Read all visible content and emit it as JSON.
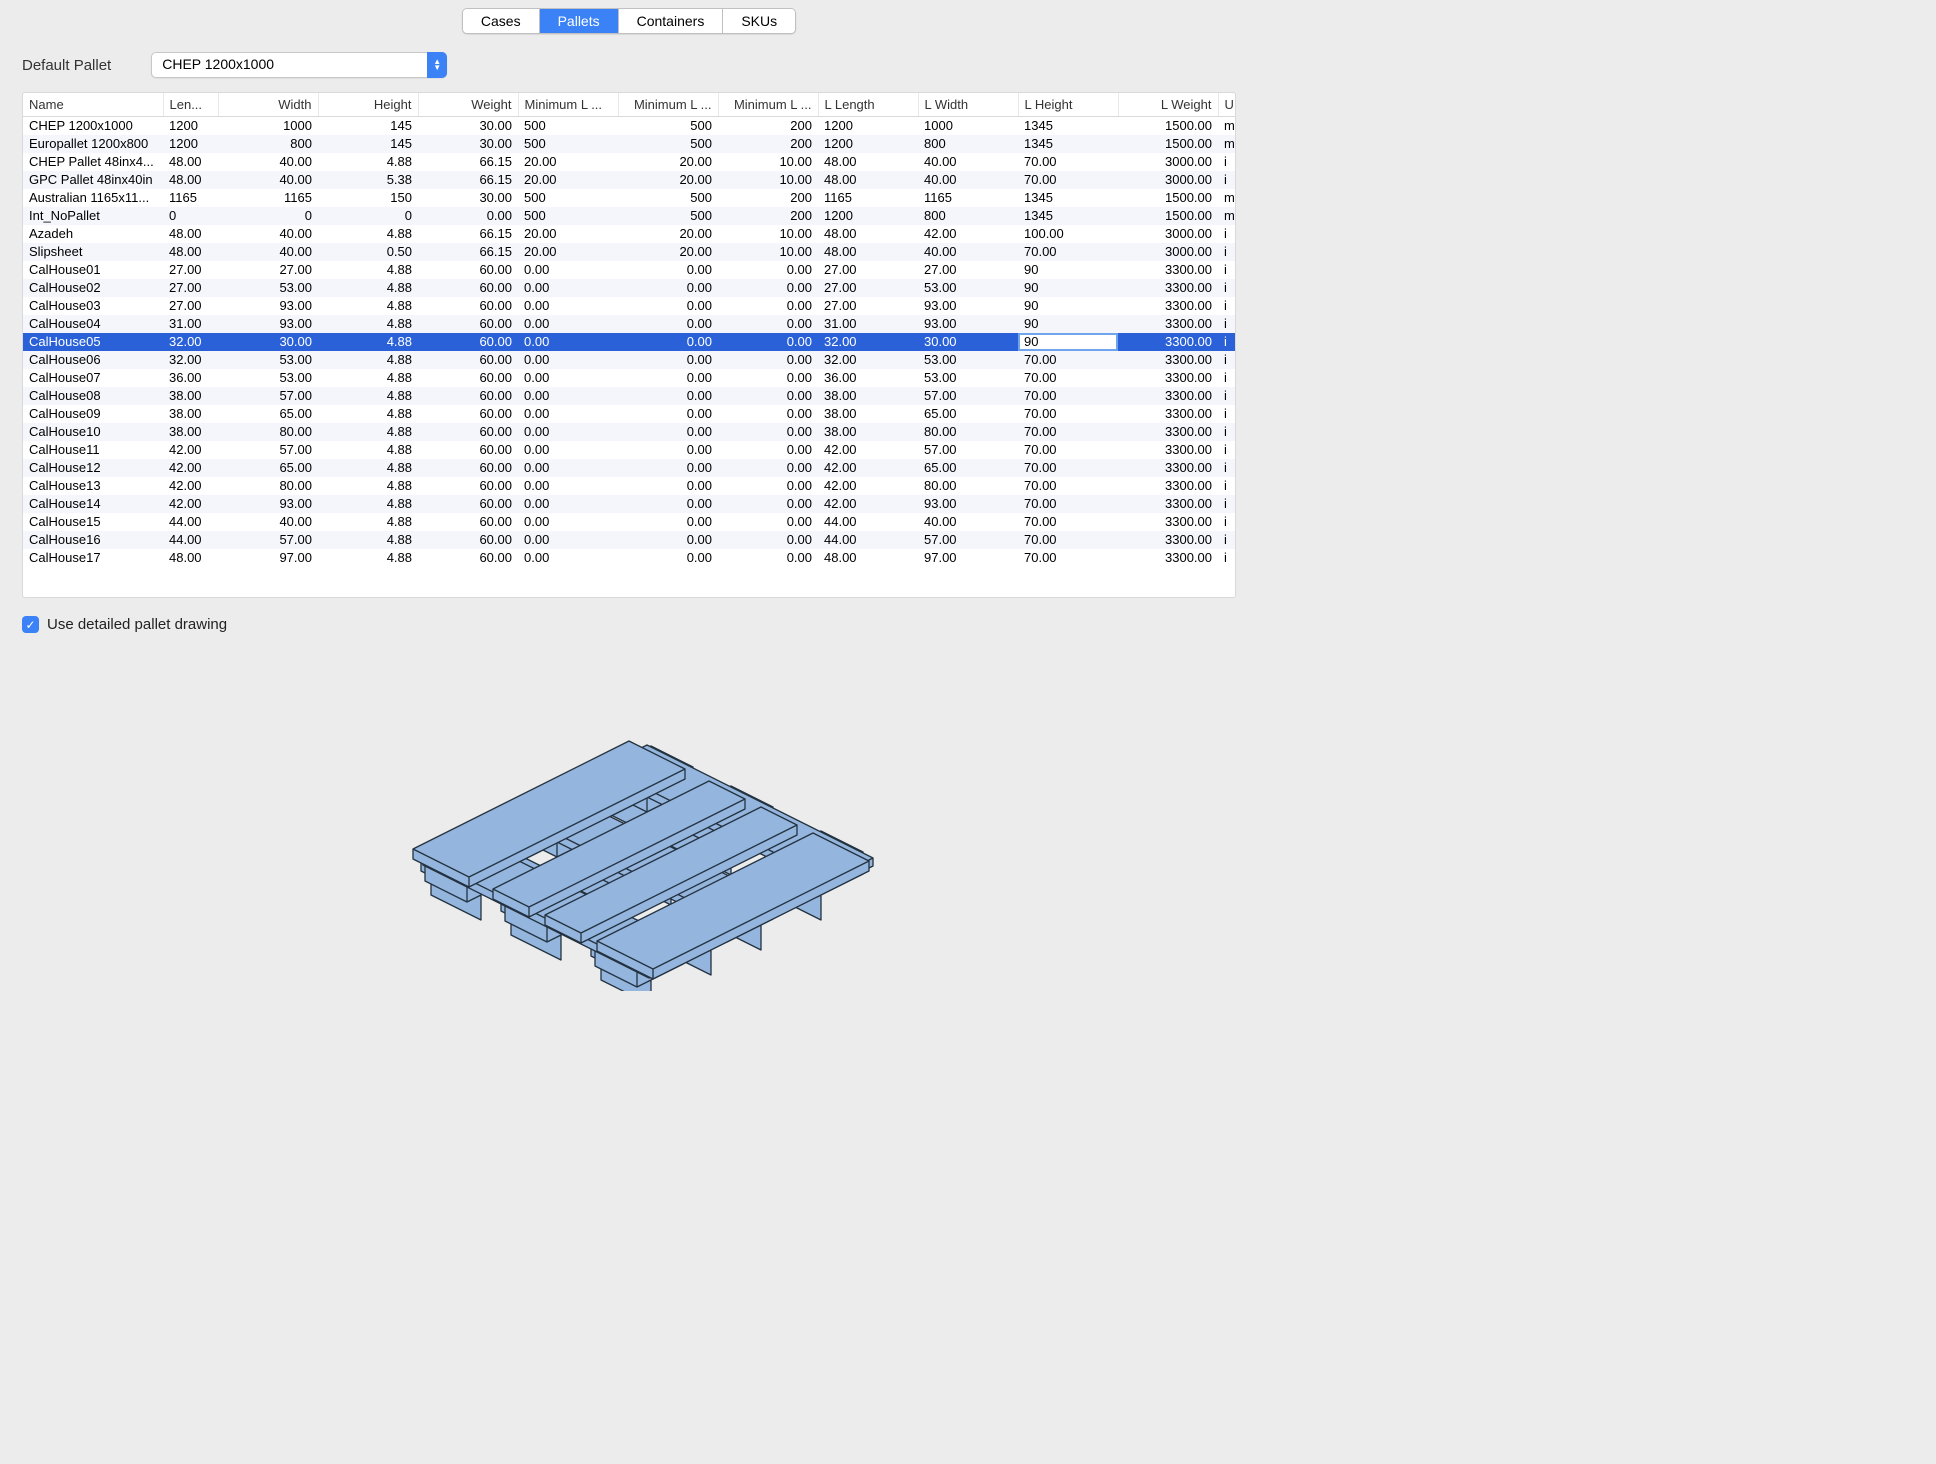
{
  "tabs": {
    "cases": "Cases",
    "pallets": "Pallets",
    "containers": "Containers",
    "skus": "SKUs"
  },
  "default_pallet": {
    "label": "Default Pallet",
    "value": "CHEP 1200x1000"
  },
  "columns": [
    "Name",
    "Len...",
    "Width",
    "Height",
    "Weight",
    "Minimum L ...",
    "Minimum L ...",
    "Minimum L ...",
    "L Length",
    "L Width",
    "L Height",
    "L Weight",
    "U..."
  ],
  "rows": [
    {
      "name": "CHEP 1200x1000",
      "len": "1200",
      "width": "1000",
      "height": "145",
      "weight": "30.00",
      "ml1": "500",
      "ml2": "500",
      "ml3": "200",
      "ll": "1200",
      "lw": "1000",
      "lh": "1345",
      "lwgt": "1500.00",
      "u": "m"
    },
    {
      "name": "Europallet 1200x800",
      "len": "1200",
      "width": "800",
      "height": "145",
      "weight": "30.00",
      "ml1": "500",
      "ml2": "500",
      "ml3": "200",
      "ll": "1200",
      "lw": "800",
      "lh": "1345",
      "lwgt": "1500.00",
      "u": "m"
    },
    {
      "name": "CHEP Pallet 48inx4...",
      "len": "48.00",
      "width": "40.00",
      "height": "4.88",
      "weight": "66.15",
      "ml1": "20.00",
      "ml2": "20.00",
      "ml3": "10.00",
      "ll": "48.00",
      "lw": "40.00",
      "lh": "70.00",
      "lwgt": "3000.00",
      "u": "i"
    },
    {
      "name": "GPC Pallet 48inx40in",
      "len": "48.00",
      "width": "40.00",
      "height": "5.38",
      "weight": "66.15",
      "ml1": "20.00",
      "ml2": "20.00",
      "ml3": "10.00",
      "ll": "48.00",
      "lw": "40.00",
      "lh": "70.00",
      "lwgt": "3000.00",
      "u": "i"
    },
    {
      "name": "Australian 1165x11...",
      "len": "1165",
      "width": "1165",
      "height": "150",
      "weight": "30.00",
      "ml1": "500",
      "ml2": "500",
      "ml3": "200",
      "ll": "1165",
      "lw": "1165",
      "lh": "1345",
      "lwgt": "1500.00",
      "u": "m"
    },
    {
      "name": "Int_NoPallet",
      "len": "0",
      "width": "0",
      "height": "0",
      "weight": "0.00",
      "ml1": "500",
      "ml2": "500",
      "ml3": "200",
      "ll": "1200",
      "lw": "800",
      "lh": "1345",
      "lwgt": "1500.00",
      "u": "m"
    },
    {
      "name": "Azadeh",
      "len": "48.00",
      "width": "40.00",
      "height": "4.88",
      "weight": "66.15",
      "ml1": "20.00",
      "ml2": "20.00",
      "ml3": "10.00",
      "ll": "48.00",
      "lw": "42.00",
      "lh": "100.00",
      "lwgt": "3000.00",
      "u": "i"
    },
    {
      "name": "Slipsheet",
      "len": "48.00",
      "width": "40.00",
      "height": "0.50",
      "weight": "66.15",
      "ml1": "20.00",
      "ml2": "20.00",
      "ml3": "10.00",
      "ll": "48.00",
      "lw": "40.00",
      "lh": "70.00",
      "lwgt": "3000.00",
      "u": "i"
    },
    {
      "name": "CalHouse01",
      "len": "27.00",
      "width": "27.00",
      "height": "4.88",
      "weight": "60.00",
      "ml1": "0.00",
      "ml2": "0.00",
      "ml3": "0.00",
      "ll": "27.00",
      "lw": "27.00",
      "lh": "90",
      "lwgt": "3300.00",
      "u": "i"
    },
    {
      "name": "CalHouse02",
      "len": "27.00",
      "width": "53.00",
      "height": "4.88",
      "weight": "60.00",
      "ml1": "0.00",
      "ml2": "0.00",
      "ml3": "0.00",
      "ll": "27.00",
      "lw": "53.00",
      "lh": "90",
      "lwgt": "3300.00",
      "u": "i"
    },
    {
      "name": "CalHouse03",
      "len": "27.00",
      "width": "93.00",
      "height": "4.88",
      "weight": "60.00",
      "ml1": "0.00",
      "ml2": "0.00",
      "ml3": "0.00",
      "ll": "27.00",
      "lw": "93.00",
      "lh": "90",
      "lwgt": "3300.00",
      "u": "i"
    },
    {
      "name": "CalHouse04",
      "len": "31.00",
      "width": "93.00",
      "height": "4.88",
      "weight": "60.00",
      "ml1": "0.00",
      "ml2": "0.00",
      "ml3": "0.00",
      "ll": "31.00",
      "lw": "93.00",
      "lh": "90",
      "lwgt": "3300.00",
      "u": "i"
    },
    {
      "name": "CalHouse05",
      "len": "32.00",
      "width": "30.00",
      "height": "4.88",
      "weight": "60.00",
      "ml1": "0.00",
      "ml2": "0.00",
      "ml3": "0.00",
      "ll": "32.00",
      "lw": "30.00",
      "lh": "90",
      "lwgt": "3300.00",
      "u": "i",
      "selected": true,
      "editing": "lh"
    },
    {
      "name": "CalHouse06",
      "len": "32.00",
      "width": "53.00",
      "height": "4.88",
      "weight": "60.00",
      "ml1": "0.00",
      "ml2": "0.00",
      "ml3": "0.00",
      "ll": "32.00",
      "lw": "53.00",
      "lh": "70.00",
      "lwgt": "3300.00",
      "u": "i"
    },
    {
      "name": "CalHouse07",
      "len": "36.00",
      "width": "53.00",
      "height": "4.88",
      "weight": "60.00",
      "ml1": "0.00",
      "ml2": "0.00",
      "ml3": "0.00",
      "ll": "36.00",
      "lw": "53.00",
      "lh": "70.00",
      "lwgt": "3300.00",
      "u": "i"
    },
    {
      "name": "CalHouse08",
      "len": "38.00",
      "width": "57.00",
      "height": "4.88",
      "weight": "60.00",
      "ml1": "0.00",
      "ml2": "0.00",
      "ml3": "0.00",
      "ll": "38.00",
      "lw": "57.00",
      "lh": "70.00",
      "lwgt": "3300.00",
      "u": "i"
    },
    {
      "name": "CalHouse09",
      "len": "38.00",
      "width": "65.00",
      "height": "4.88",
      "weight": "60.00",
      "ml1": "0.00",
      "ml2": "0.00",
      "ml3": "0.00",
      "ll": "38.00",
      "lw": "65.00",
      "lh": "70.00",
      "lwgt": "3300.00",
      "u": "i"
    },
    {
      "name": "CalHouse10",
      "len": "38.00",
      "width": "80.00",
      "height": "4.88",
      "weight": "60.00",
      "ml1": "0.00",
      "ml2": "0.00",
      "ml3": "0.00",
      "ll": "38.00",
      "lw": "80.00",
      "lh": "70.00",
      "lwgt": "3300.00",
      "u": "i"
    },
    {
      "name": "CalHouse11",
      "len": "42.00",
      "width": "57.00",
      "height": "4.88",
      "weight": "60.00",
      "ml1": "0.00",
      "ml2": "0.00",
      "ml3": "0.00",
      "ll": "42.00",
      "lw": "57.00",
      "lh": "70.00",
      "lwgt": "3300.00",
      "u": "i"
    },
    {
      "name": "CalHouse12",
      "len": "42.00",
      "width": "65.00",
      "height": "4.88",
      "weight": "60.00",
      "ml1": "0.00",
      "ml2": "0.00",
      "ml3": "0.00",
      "ll": "42.00",
      "lw": "65.00",
      "lh": "70.00",
      "lwgt": "3300.00",
      "u": "i"
    },
    {
      "name": "CalHouse13",
      "len": "42.00",
      "width": "80.00",
      "height": "4.88",
      "weight": "60.00",
      "ml1": "0.00",
      "ml2": "0.00",
      "ml3": "0.00",
      "ll": "42.00",
      "lw": "80.00",
      "lh": "70.00",
      "lwgt": "3300.00",
      "u": "i"
    },
    {
      "name": "CalHouse14",
      "len": "42.00",
      "width": "93.00",
      "height": "4.88",
      "weight": "60.00",
      "ml1": "0.00",
      "ml2": "0.00",
      "ml3": "0.00",
      "ll": "42.00",
      "lw": "93.00",
      "lh": "70.00",
      "lwgt": "3300.00",
      "u": "i"
    },
    {
      "name": "CalHouse15",
      "len": "44.00",
      "width": "40.00",
      "height": "4.88",
      "weight": "60.00",
      "ml1": "0.00",
      "ml2": "0.00",
      "ml3": "0.00",
      "ll": "44.00",
      "lw": "40.00",
      "lh": "70.00",
      "lwgt": "3300.00",
      "u": "i"
    },
    {
      "name": "CalHouse16",
      "len": "44.00",
      "width": "57.00",
      "height": "4.88",
      "weight": "60.00",
      "ml1": "0.00",
      "ml2": "0.00",
      "ml3": "0.00",
      "ll": "44.00",
      "lw": "57.00",
      "lh": "70.00",
      "lwgt": "3300.00",
      "u": "i"
    },
    {
      "name": "CalHouse17",
      "len": "48.00",
      "width": "97.00",
      "height": "4.88",
      "weight": "60.00",
      "ml1": "0.00",
      "ml2": "0.00",
      "ml3": "0.00",
      "ll": "48.00",
      "lw": "97.00",
      "lh": "70.00",
      "lwgt": "3300.00",
      "u": "i"
    }
  ],
  "use_detailed_drawing": {
    "label": "Use detailed pallet drawing",
    "checked": true
  },
  "colors": {
    "accent": "#3a82f6",
    "pallet_fill": "#94b5dd",
    "pallet_stroke": "#243240"
  }
}
